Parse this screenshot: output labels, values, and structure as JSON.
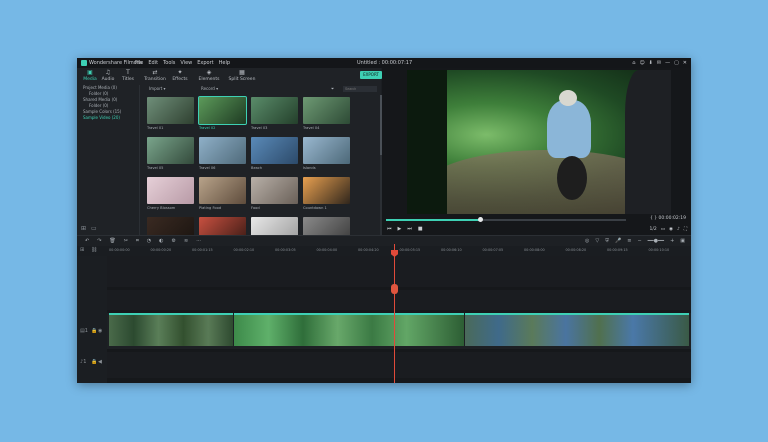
{
  "titlebar": {
    "app": "Wondershare Filmora",
    "menus": [
      "File",
      "Edit",
      "Tools",
      "View",
      "Export",
      "Help"
    ],
    "title": "Untitled : 00:00:07:17",
    "controls": [
      "⌂",
      "☺",
      "⬇",
      "✉",
      "—",
      "▢",
      "✕"
    ]
  },
  "tabs": [
    {
      "label": "Media",
      "icon": "folder-icon"
    },
    {
      "label": "Audio",
      "icon": "music-icon"
    },
    {
      "label": "Titles",
      "icon": "text-icon"
    },
    {
      "label": "Transition",
      "icon": "transition-icon"
    },
    {
      "label": "Effects",
      "icon": "effects-icon"
    },
    {
      "label": "Elements",
      "icon": "elements-icon"
    },
    {
      "label": "Split Screen",
      "icon": "split-screen-icon"
    }
  ],
  "export_label": "EXPORT",
  "sidebar": [
    {
      "label": "Project Media (0)"
    },
    {
      "label": "Folder (0)"
    },
    {
      "label": "Shared Media (0)"
    },
    {
      "label": "Folder (0)"
    },
    {
      "label": "Sample Colors (15)"
    },
    {
      "label": "Sample Video (20)"
    }
  ],
  "library_bar": {
    "import": "Import",
    "record": "Record",
    "search_placeholder": "Search"
  },
  "media": [
    {
      "caption": "Travel 01",
      "c1": "#6f8f7a",
      "c2": "#2f4030"
    },
    {
      "caption": "Travel 02",
      "c1": "#5c9a5a",
      "c2": "#1e3a22"
    },
    {
      "caption": "Travel 03",
      "c1": "#5a8c6a",
      "c2": "#24402b"
    },
    {
      "caption": "Travel 04",
      "c1": "#6e9a74",
      "c2": "#2d4a35"
    },
    {
      "caption": "Travel 05",
      "c1": "#7aa58c",
      "c2": "#334a3b"
    },
    {
      "caption": "Travel 06",
      "c1": "#8fb0c8",
      "c2": "#4f6a7a"
    },
    {
      "caption": "Beach",
      "c1": "#5a8ab8",
      "c2": "#2c4a6a"
    },
    {
      "caption": "Islands",
      "c1": "#9ab8d0",
      "c2": "#4c6878"
    },
    {
      "caption": "Cherry Blossom",
      "c1": "#e6d0d8",
      "c2": "#b89aa6"
    },
    {
      "caption": "Plating Food",
      "c1": "#b8a38a",
      "c2": "#5e4c3c"
    },
    {
      "caption": "Food",
      "c1": "#b8b0a8",
      "c2": "#6a6058"
    },
    {
      "caption": "Countdown 1",
      "c1": "#e8a050",
      "c2": "#30261c"
    },
    {
      "caption": "",
      "c1": "#3a2a22",
      "c2": "#1a1410"
    },
    {
      "caption": "",
      "c1": "#c85040",
      "c2": "#3a1a14"
    },
    {
      "caption": "",
      "c1": "#e8e8e8",
      "c2": "#9a9a9a"
    },
    {
      "caption": "",
      "c1": "#8a8a8a",
      "c2": "#3a3a3a"
    }
  ],
  "preview": {
    "timecode": "00:00:02:19",
    "progress": 0.39,
    "zoom": "1/2"
  },
  "ruler_ticks": [
    "00:00:00:00",
    "00:00:00:20",
    "00:00:01:15",
    "00:00:02:10",
    "00:00:03:05",
    "00:00:04:00",
    "00:00:04:20",
    "00:00:05:15",
    "00:00:06:10",
    "00:00:07:05",
    "00:00:08:00",
    "00:00:08:20",
    "00:00:09:15",
    "00:00:10:10"
  ]
}
